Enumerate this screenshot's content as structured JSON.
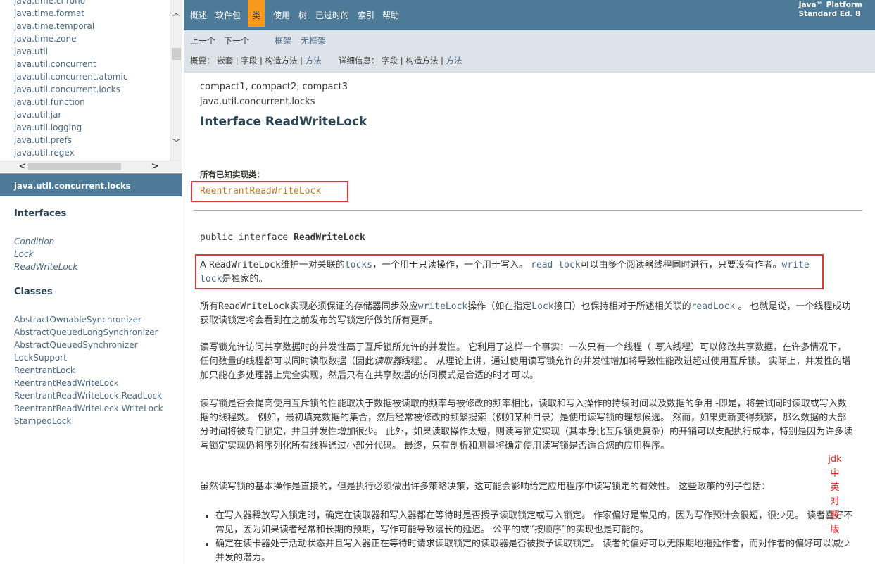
{
  "package_list": [
    "java.time.chrono",
    "java.time.format",
    "java.time.temporal",
    "java.time.zone",
    "java.util",
    "java.util.concurrent",
    "java.util.concurrent.atomic",
    "java.util.concurrent.locks",
    "java.util.function",
    "java.util.jar",
    "java.util.logging",
    "java.util.prefs",
    "java.util.regex"
  ],
  "scroll_arrows": {
    "up": "︿",
    "down": "﹀",
    "left": "<",
    "right": ">"
  },
  "class_frame": {
    "header": "java.util.concurrent.locks",
    "interfaces_heading": "Interfaces",
    "interfaces": [
      "Condition",
      "Lock",
      "ReadWriteLock"
    ],
    "classes_heading": "Classes",
    "classes": [
      "AbstractOwnableSynchronizer",
      "AbstractQueuedLongSynchronizer",
      "AbstractQueuedSynchronizer",
      "LockSupport",
      "ReentrantLock",
      "ReentrantReadWriteLock",
      "ReentrantReadWriteLock.ReadLock",
      "ReentrantReadWriteLock.WriteLock",
      "StampedLock"
    ]
  },
  "topnav": {
    "items": [
      "概述",
      "软件包",
      "类",
      "使用",
      "树",
      "已过时的",
      "索引",
      "帮助"
    ],
    "active": "类",
    "platform_line1": "Java™ Platform",
    "platform_line2": "Standard Ed. 8"
  },
  "subnav": {
    "prev": "上一个",
    "next": "下一个",
    "frames": "框架",
    "no_frames": "无框架",
    "summary_label": "概要：",
    "summary_items": [
      "嵌套",
      "字段",
      "构造方法",
      "方法"
    ],
    "detail_label": "详细信息：",
    "detail_items": [
      "字段",
      "构造方法",
      "方法"
    ],
    "separator": " | "
  },
  "main": {
    "profiles": "compact1, compact2, compact3",
    "package": "java.util.concurrent.locks",
    "title": "Interface ReadWriteLock",
    "known_impl_label": "所有已知实现类：",
    "known_impl": "ReentrantReadWriteLock",
    "signature_prefix": "public interface ",
    "signature_name": "ReadWriteLock",
    "p1": {
      "a": "A ",
      "code1": "ReadWriteLock",
      "b": "维护一对关联的",
      "code2": "locks",
      "c": "，一个用于只读操作，一个用于写入。 ",
      "code3": "read lock",
      "d": "可以由多个阅读器线程同时进行，只要没有作者。",
      "code4": "write lock",
      "e": "是独家的。"
    },
    "p2": {
      "a": "所有",
      "code1": "ReadWriteLock",
      "b": "实现必须保证的存储器同步效应",
      "code2": "writeLock",
      "c": "操作（如在指定",
      "code3": "Lock",
      "d": "接口）也保持相对于所述相关联的",
      "code4": "readLock",
      "e": " 。 也就是说，一个线程成功获取读锁定将会看到在之前发布的写锁定所做的所有更新。"
    },
    "p3": {
      "a": "读写锁允许访问共享数据时的并发性高于互斥锁所允许的并发性。 它利用了这样一个事实：一次只有一个线程（ ",
      "em1": "写入",
      "b": "线程）可以修改共享数据，在许多情况下，任何数量的线程都可以同时读取数据（因此",
      "em2": "读取器",
      "c": "线程）。 从理论上讲，通过使用读写锁允许的并发性增加将导致性能改进超过使用互斥锁。 实际上，并发性的增加只能在多处理器上完全实现，然后只有在共享数据的访问模式是合适的时才可以。"
    },
    "p4": "读写锁是否会提高使用互斥锁的性能取决于数据被读取的频率与被修改的频率相比，读取和写入操作的持续时间以及数据的争用 -即是，将尝试同时读取或写入数据的线程数。 例如，最初填充数据的集合，然后经常被修改的频繁搜索（例如某种目录）是使用读写锁的理想候选。 然而，如果更新变得频繁，那么数据的大部分时间将被专门锁定，并且并发性增加很少。 此外，如果读取操作太短，则读写锁定实现（其本身比互斥锁更复杂）的开销可以支配执行成本，特别是因为许多读写锁定实现仍将序列化所有线程通过小部分代码。 最终，只有剖析和测量将确定使用读写锁是否适合您的应用程序。",
    "p5": "虽然读写锁的基本操作是直接的，但是执行必须做出许多策略决策，这可能会影响给定应用程序中读写锁定的有效性。 这些政策的例子包括：",
    "bullets": [
      "在写入器释放写入锁定时，确定在读取器和写入器都在等待时是否授予读取锁定或写入锁定。 作家偏好是常见的，因为写作预计会很短，很少见。 读者喜好不常见，因为如果读者经常和长期的预期，写作可能导致漫长的延迟。 公平的或“按顺序”的实现也是可能的。",
      "确定在读卡器处于活动状态并且写入器正在等待时请求读取锁定的读取器是否被授予读取锁定。 读者的偏好可以无限期地拖延作者，而对作者的偏好可以减少并发的潜力。"
    ],
    "watermark": [
      "jdk",
      "中",
      "英",
      "对",
      "照",
      "版"
    ]
  },
  "colors": {
    "nav_bg": "#4d7a97",
    "nav_active": "#f8981d",
    "subnav_bg": "#dee3e9",
    "link": "#4a6782",
    "highlight_box": "#d9393b"
  }
}
